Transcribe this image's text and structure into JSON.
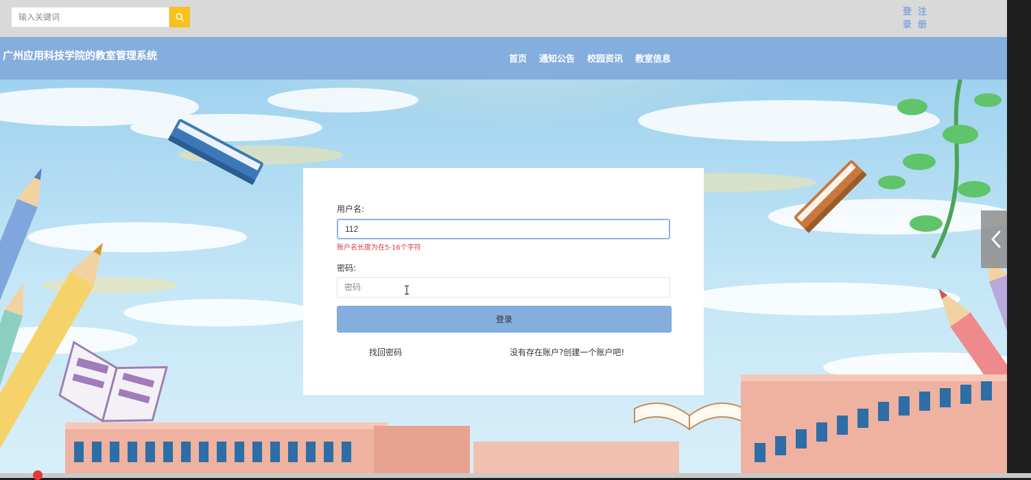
{
  "search": {
    "placeholder": "输入关键词",
    "value": ""
  },
  "auth": {
    "login": "登录",
    "register": "注册"
  },
  "site": {
    "title": "广州应用科技学院的教室管理系统"
  },
  "nav": {
    "items": [
      "首页",
      "通知公告",
      "校园资讯",
      "教室信息"
    ]
  },
  "login_form": {
    "username_label": "用户名:",
    "username_value": "112",
    "username_error": "账户名长度为在5-16个字符",
    "password_label": "密码:",
    "password_placeholder": "密码",
    "submit": "登录",
    "forgot_link": "找回密码",
    "register_link": "没有存在账户?创建一个账户吧!"
  },
  "colors": {
    "nav_bar": "#84aedd",
    "search_button": "#f7c21b",
    "error_text": "#d83b3b",
    "page_top": "#d9d9d9"
  },
  "icons": {
    "search": "search-icon",
    "side_tab": "chevron-left-icon"
  }
}
